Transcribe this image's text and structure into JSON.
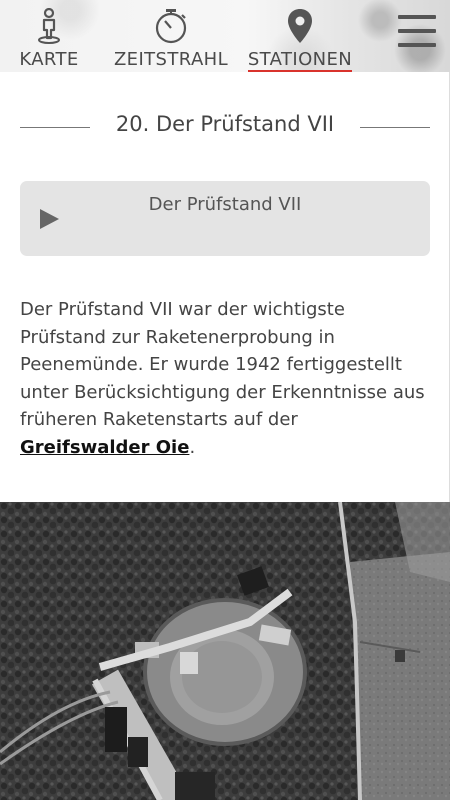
{
  "nav": {
    "items": [
      {
        "label": "KARTE",
        "icon": "walking-person-icon"
      },
      {
        "label": "ZEITSTRAHL",
        "icon": "stopwatch-icon"
      },
      {
        "label": "STATIONEN",
        "icon": "map-pin-icon",
        "active": true
      }
    ],
    "menu_icon": "hamburger-menu-icon",
    "active_color": "#d9322c"
  },
  "station": {
    "title": "20. Der Prüfstand VII"
  },
  "audio": {
    "title": "Der Prüfstand VII",
    "icon": "play-icon"
  },
  "description": {
    "text": "Der Prüfstand VII war der wichtigste Prüfstand zur Raketenerprobung in Peenemünde. Er wurde 1942 fertiggestellt unter Berücksichtigung der Erkenntnisse aus früheren Raketenstarts auf der ",
    "link_text": "Greifswalder Oie",
    "trailing": "."
  },
  "photo": {
    "subject": "aerial-photo-pruefstand-vii"
  }
}
